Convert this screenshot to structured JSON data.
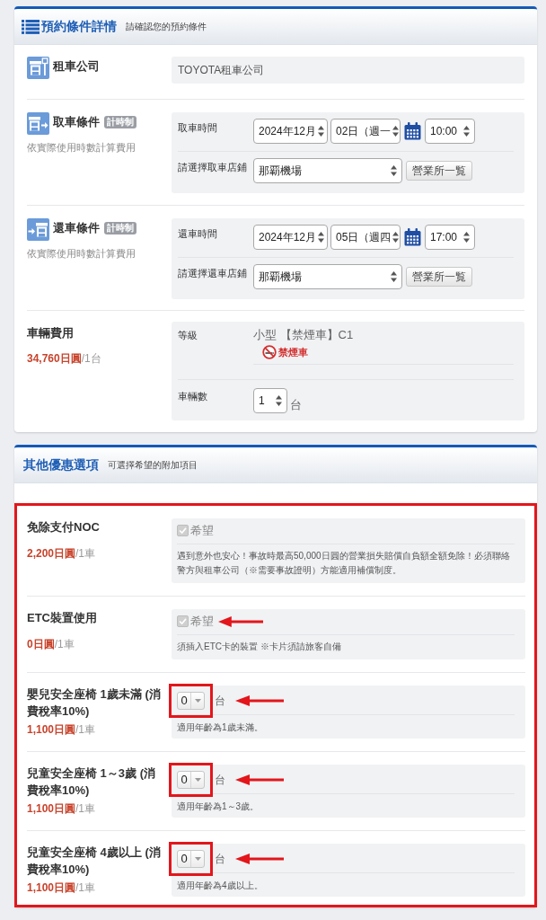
{
  "reservation": {
    "title": "預約條件詳情",
    "subtitle": "請確認您的預約條件",
    "rows": [
      {
        "kind": "company",
        "label": "租車公司",
        "value": "TOYOTA租車公司"
      },
      {
        "kind": "pickup",
        "label": "取車條件",
        "badge": "計時制",
        "note": "依實際使用時數計算費用",
        "fields": [
          {
            "kind": "datetime",
            "label": "取車時間",
            "month": "2024年12月",
            "day": "02日（週一",
            "time": "10:00"
          },
          {
            "kind": "store",
            "label": "請選擇取車店鋪",
            "value": "那覇機場",
            "button": "營業所一覧"
          }
        ]
      },
      {
        "kind": "return",
        "label": "還車條件",
        "badge": "計時制",
        "note": "依實際使用時數計算費用",
        "fields": [
          {
            "kind": "datetime",
            "label": "還車時間",
            "month": "2024年12月",
            "day": "05日（週四",
            "time": "17:00"
          },
          {
            "kind": "store",
            "label": "請選擇還車店鋪",
            "value": "那覇機場",
            "button": "營業所一覧"
          }
        ]
      },
      {
        "kind": "vehicle",
        "label": "車輛費用",
        "price": "34,760日圓",
        "price_unit": "/1台",
        "fields": [
          {
            "kind": "class",
            "label": "等級",
            "value": "小型 【禁煙車】C1",
            "tag": "禁煙車"
          },
          {
            "kind": "count",
            "label": "車輛數",
            "value": "1",
            "unit": "台"
          }
        ]
      }
    ]
  },
  "options": {
    "title": "其他優惠選項",
    "subtitle": "可選擇希望的附加項目",
    "highlighted": true,
    "items": [
      {
        "kind": "checkbox",
        "label": "免除支付NOC",
        "price": "2,200日圓",
        "price_unit": "/1車",
        "option_label": "希望",
        "checked": true,
        "disabled": true,
        "framed": false,
        "arrow": false,
        "description": "遇到意外也安心！事故時最高50,000日圓的營業損失賠償自負額全額免除！必須聯絡警方與租車公司（※需要事故證明）方能適用補償制度。"
      },
      {
        "kind": "checkbox",
        "label": "ETC裝置使用",
        "price": "0日圓",
        "price_unit": "/1車",
        "option_label": "希望",
        "checked": true,
        "disabled": true,
        "framed": false,
        "arrow": true,
        "description": "須插入ETC卡的裝置 ※卡片須請旅客自備"
      },
      {
        "kind": "quantity",
        "label": "嬰兒安全座椅 1歲未滿 (消費稅率10%)",
        "price": "1,100日圓",
        "price_unit": "/1車",
        "value": "0",
        "count_unit": "台",
        "framed": true,
        "arrow": true,
        "description": "適用年齡為1歲未滿。"
      },
      {
        "kind": "quantity",
        "label": "兒童安全座椅 1～3歲 (消費稅率10%)",
        "price": "1,100日圓",
        "price_unit": "/1車",
        "value": "0",
        "count_unit": "台",
        "framed": true,
        "arrow": true,
        "description": "適用年齡為1～3歲。"
      },
      {
        "kind": "quantity",
        "label": "兒童安全座椅 4歲以上 (消費稅率10%)",
        "price": "1,100日圓",
        "price_unit": "/1車",
        "value": "0",
        "count_unit": "台",
        "framed": true,
        "arrow": true,
        "description": "適用年齡為4歲以上。"
      }
    ]
  }
}
